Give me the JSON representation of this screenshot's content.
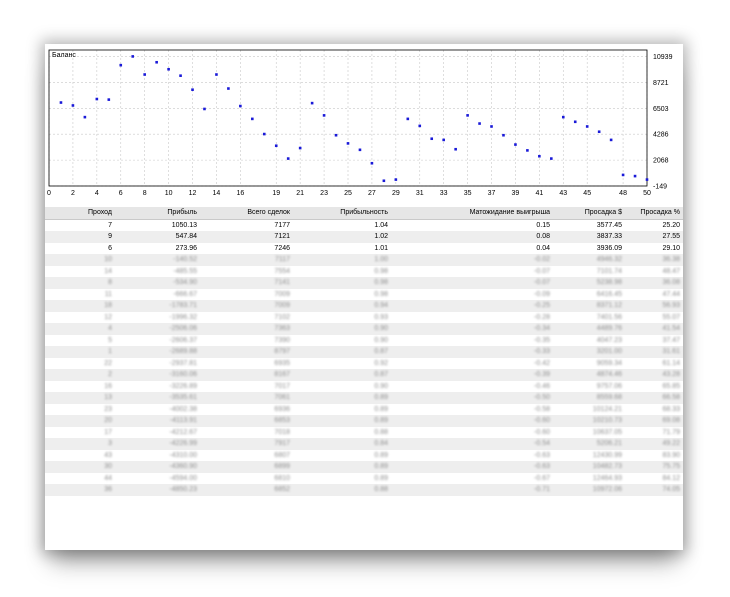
{
  "chart_data": {
    "type": "scatter",
    "title": "Баланс",
    "xlabel": "",
    "ylabel": "",
    "xlim": [
      0,
      50
    ],
    "ylim": [
      -149,
      11500
    ],
    "x_ticks": [
      0,
      2,
      4,
      6,
      8,
      10,
      12,
      14,
      16,
      19,
      21,
      23,
      25,
      27,
      29,
      31,
      33,
      35,
      37,
      39,
      41,
      43,
      45,
      48,
      50
    ],
    "y_ticks": [
      10939,
      8721,
      6503,
      4286,
      2068,
      -149
    ],
    "grid": true,
    "point_color": "#1a1ad8",
    "x": [
      1,
      2,
      3,
      4,
      5,
      6,
      7,
      8,
      9,
      10,
      11,
      12,
      13,
      14,
      15,
      16,
      17,
      18,
      19,
      20,
      21,
      22,
      23,
      24,
      25,
      26,
      27,
      28,
      29,
      30,
      31,
      32,
      33,
      34,
      35,
      36,
      37,
      38,
      39,
      40,
      41,
      42,
      43,
      44,
      45,
      46,
      47,
      48,
      49,
      50
    ],
    "values": [
      7000,
      6750,
      5750,
      7300,
      7250,
      10200,
      10950,
      9400,
      10450,
      9850,
      9300,
      8100,
      6450,
      9400,
      8200,
      6700,
      5600,
      4300,
      3300,
      2200,
      3100,
      6950,
      5900,
      4200,
      3500,
      2950,
      1800,
      300,
      400,
      5600,
      5000,
      3900,
      3800,
      3000,
      5900,
      5200,
      4950,
      4200,
      3400,
      2900,
      2400,
      2200,
      5750,
      5350,
      4950,
      4500,
      3800,
      800,
      700,
      400
    ]
  },
  "table": {
    "columns": [
      "Проход",
      "Прибыль",
      "Всего сделок",
      "Прибыльность",
      "Матожидание выигрыша",
      "Просадка $",
      "Просадка %"
    ],
    "rows": [
      [
        "7",
        "1050.13",
        "7177",
        "1.04",
        "0.15",
        "3577.45",
        "25.20"
      ],
      [
        "9",
        "547.84",
        "7121",
        "1.02",
        "0.08",
        "3837.33",
        "27.55"
      ],
      [
        "6",
        "273.96",
        "7246",
        "1.01",
        "0.04",
        "3936.09",
        "29.10"
      ],
      [
        "10",
        "-140.52",
        "7117",
        "1.00",
        "-0.02",
        "4946.32",
        "36.38"
      ],
      [
        "14",
        "-485.55",
        "7554",
        "0.98",
        "-0.07",
        "7101.74",
        "48.47"
      ],
      [
        "8",
        "-534.90",
        "7141",
        "0.98",
        "-0.07",
        "5238.98",
        "36.08"
      ],
      [
        "11",
        "-666.67",
        "7009",
        "0.98",
        "-0.09",
        "6416.45",
        "47.44"
      ],
      [
        "18",
        "-1783.71",
        "7009",
        "0.94",
        "-0.25",
        "8371.12",
        "56.93"
      ],
      [
        "12",
        "-1996.32",
        "7102",
        "0.93",
        "-0.28",
        "7401.56",
        "55.07"
      ],
      [
        "4",
        "-2506.06",
        "7363",
        "0.90",
        "-0.34",
        "4489.76",
        "41.54"
      ],
      [
        "5",
        "-2606.37",
        "7390",
        "0.90",
        "-0.35",
        "4047.23",
        "37.47"
      ],
      [
        "1",
        "-2689.88",
        "8797",
        "0.87",
        "-0.33",
        "3201.00",
        "31.61"
      ],
      [
        "22",
        "-2937.81",
        "6935",
        "0.92",
        "-0.42",
        "9059.34",
        "61.14"
      ],
      [
        "2",
        "-3160.06",
        "8167",
        "0.87",
        "-0.39",
        "4874.46",
        "43.28"
      ],
      [
        "16",
        "-3226.89",
        "7017",
        "0.90",
        "-0.46",
        "9757.06",
        "65.85"
      ],
      [
        "13",
        "-3535.61",
        "7061",
        "0.89",
        "-0.50",
        "8559.68",
        "66.58"
      ],
      [
        "23",
        "-4002.38",
        "6936",
        "0.89",
        "-0.58",
        "10124.21",
        "68.33"
      ],
      [
        "20",
        "-4113.91",
        "6853",
        "0.89",
        "-0.60",
        "10210.73",
        "69.08"
      ],
      [
        "17",
        "-4212.67",
        "7018",
        "0.88",
        "-0.60",
        "10637.05",
        "71.79"
      ],
      [
        "3",
        "-4226.99",
        "7917",
        "0.84",
        "-0.54",
        "5206.21",
        "49.22"
      ],
      [
        "43",
        "-4310.00",
        "6807",
        "0.89",
        "-0.63",
        "12430.99",
        "83.90"
      ],
      [
        "30",
        "-4360.90",
        "6899",
        "0.89",
        "-0.63",
        "10482.73",
        "75.75"
      ],
      [
        "44",
        "-4594.00",
        "6810",
        "0.89",
        "-0.67",
        "12464.93",
        "84.12"
      ],
      [
        "36",
        "-4850.23",
        "6852",
        "0.88",
        "-0.71",
        "10972.06",
        "74.05"
      ]
    ]
  }
}
